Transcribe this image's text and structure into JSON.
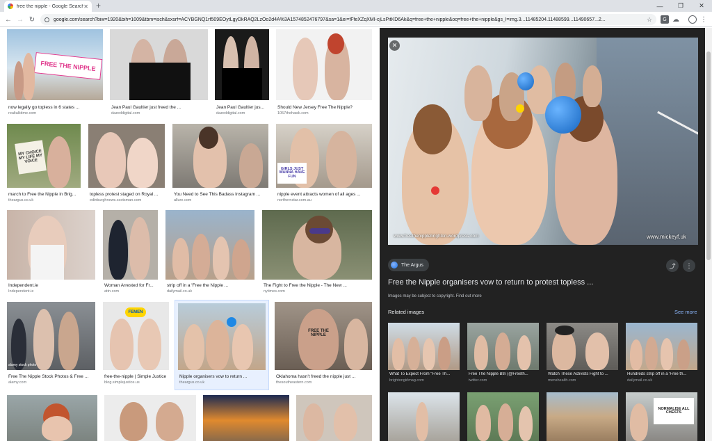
{
  "browser": {
    "tab_title": "free the nipple - Google Search",
    "url": "google.com/search?biw=1920&bih=1009&tbm=isch&sxsrf=ACYBGNQ1rf509EOytLgyDkRAQ2LzOo2d4A%3A1574852476797&sa=1&ei=fFfeXZqXMI-cjLsPitKD6Ak&q=free+the+nipple&oq=free+the+nipple&gs_l=img.3...11485204.11488599...11490657...2...",
    "ext_badge": "G"
  },
  "results": [
    {
      "title": "now legally go topless in 6 states ...",
      "source": "realtalktime.com",
      "sign": "FREE THE NIPPLE"
    },
    {
      "title": "Jean Paul Gaultier just freed the ...",
      "source": "dazeddigital.com"
    },
    {
      "title": "Jean Paul Gaultier jus...",
      "source": "dazeddigital.com"
    },
    {
      "title": "Should New Jersey Free The Nipple?",
      "source": "1057thehawk.com"
    },
    {
      "title": "march to Free the Nipple in Brig...",
      "source": "theargus.co.uk",
      "sign": "MY CHOICE MY LIFE MY VOICE"
    },
    {
      "title": "topless protest staged on Royal ...",
      "source": "edinburghnews.scotsman.com"
    },
    {
      "title": "You Need to See This Badass Instagram ...",
      "source": "allure.com"
    },
    {
      "title": "nipple event attracts women of all ages ...",
      "source": "northernstar.com.au",
      "sign": "GIRLS JUST WANNA HAVE FUN"
    },
    {
      "title": "Independent.ie",
      "source": "Independent.ie"
    },
    {
      "title": "Woman Arrested for Fr...",
      "source": "attn.com"
    },
    {
      "title": "strip off in a 'Free the Nipple ...",
      "source": "dailymail.co.uk"
    },
    {
      "title": "The Fight to Free the Nipple - The New ...",
      "source": "nytimes.com"
    },
    {
      "title": "Free The Nipple Stock Photos & Free ...",
      "source": "alamy.com",
      "stock": "alamy stock photo"
    },
    {
      "title": "free-the-nipple | Simple Justice",
      "source": "blog.simplejustice.us",
      "sign": "FEMEN"
    },
    {
      "title": "Nipple organisers vow to return ...",
      "source": "theargus.co.uk"
    },
    {
      "title": "Oklahoma hasn't freed the nipple just ...",
      "source": "thesoutheastern.com",
      "sign": "FREE THE NIPPLE"
    },
    {
      "title": "",
      "source": ""
    },
    {
      "title": "",
      "source": ""
    },
    {
      "title": "",
      "source": ""
    },
    {
      "title": "",
      "source": ""
    }
  ],
  "preview": {
    "source_name": "The Argus",
    "title": "Free the Nipple organisers vow to return to protest topless ...",
    "copyright": "Images may be subject to copyright.",
    "find_out_more": "Find out more",
    "watermark_left": "www.freethenipplebrighton.wordpress.com",
    "watermark_right": "www.mickeyf.uk",
    "related_label": "Related images",
    "see_more": "See more",
    "related": [
      {
        "title": "What To Expect From \"Free Th...",
        "source": "brightongirlmag.com"
      },
      {
        "title": "Free The Nipple Btn (@Freeth...",
        "source": "twitter.com"
      },
      {
        "title": "Watch These Activists Fight to ...",
        "source": "menshealth.com"
      },
      {
        "title": "Hundreds strip off in a 'Free th...",
        "source": "dailymail.co.uk"
      },
      {
        "title": "",
        "source": ""
      },
      {
        "title": "",
        "source": ""
      },
      {
        "title": "",
        "source": ""
      },
      {
        "title": "",
        "source": "",
        "sign": "NORMALISE ALL CHESTS"
      }
    ]
  },
  "colors": {
    "panel_bg": "#222222",
    "link_blue": "#8ab4f8",
    "selected_bg": "#e8f0fe"
  }
}
